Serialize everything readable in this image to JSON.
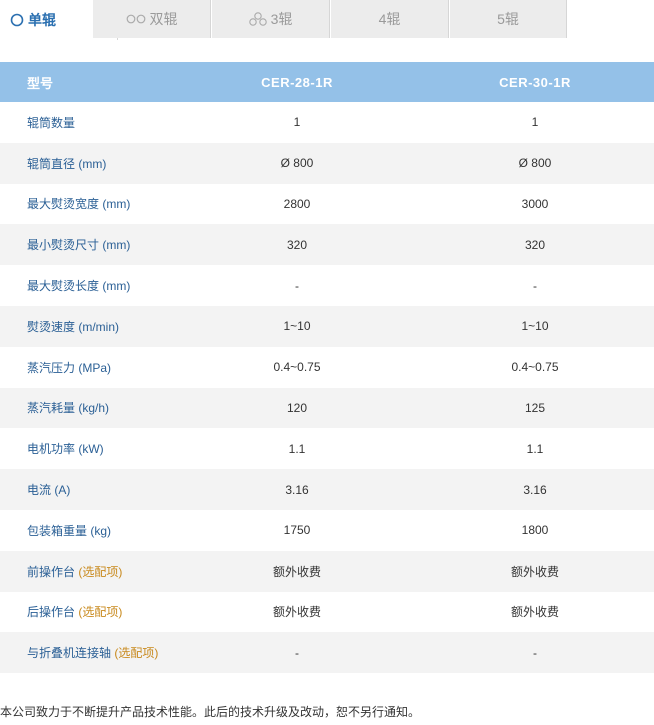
{
  "tabs": [
    {
      "label": "单辊",
      "icon": "single-roller-icon",
      "active": true
    },
    {
      "label": "双辊",
      "icon": "double-roller-icon",
      "active": false
    },
    {
      "label": "3辊",
      "icon": "triple-roller-icon",
      "active": false
    },
    {
      "label": "4辊",
      "icon": "",
      "active": false
    },
    {
      "label": "5辊",
      "icon": "",
      "active": false
    }
  ],
  "colors": {
    "accent": "#2a6fb0",
    "header_bg": "#94c1e8",
    "alt_row_bg": "#f3f3f3",
    "option_text": "#c8891c"
  },
  "table": {
    "header": {
      "label": "型号",
      "col1": "CER-28-1R",
      "col2": "CER-30-1R"
    },
    "rows": [
      {
        "label": "辊筒数量",
        "opt": "",
        "col1": "1",
        "col2": "1"
      },
      {
        "label": "辊筒直径 (mm)",
        "opt": "",
        "col1": "Ø 800",
        "col2": "Ø 800"
      },
      {
        "label": "最大熨烫宽度 (mm)",
        "opt": "",
        "col1": "2800",
        "col2": "3000"
      },
      {
        "label": "最小熨烫尺寸 (mm)",
        "opt": "",
        "col1": "320",
        "col2": "320"
      },
      {
        "label": "最大熨烫长度 (mm)",
        "opt": "",
        "col1": "-",
        "col2": "-"
      },
      {
        "label": "熨烫速度 (m/min)",
        "opt": "",
        "col1": "1~10",
        "col2": "1~10"
      },
      {
        "label": "蒸汽压力 (MPa)",
        "opt": "",
        "col1": "0.4~0.75",
        "col2": "0.4~0.75"
      },
      {
        "label": "蒸汽耗量 (kg/h)",
        "opt": "",
        "col1": "120",
        "col2": "125"
      },
      {
        "label": "电机功率 (kW)",
        "opt": "",
        "col1": "1.1",
        "col2": "1.1"
      },
      {
        "label": "电流 (A)",
        "opt": "",
        "col1": "3.16",
        "col2": "3.16"
      },
      {
        "label": "包装箱重量 (kg)",
        "opt": "",
        "col1": "1750",
        "col2": "1800"
      },
      {
        "label": "前操作台",
        "opt": "(选配项)",
        "col1": "额外收费",
        "col2": "额外收费"
      },
      {
        "label": "后操作台",
        "opt": "(选配项)",
        "col1": "额外收费",
        "col2": "额外收费"
      },
      {
        "label": "与折叠机连接轴",
        "opt": "(选配项)",
        "col1": "-",
        "col2": "-"
      }
    ]
  },
  "footnote": "本公司致力于不断提升产品技术性能。此后的技术升级及改动，恕不另行通知。"
}
